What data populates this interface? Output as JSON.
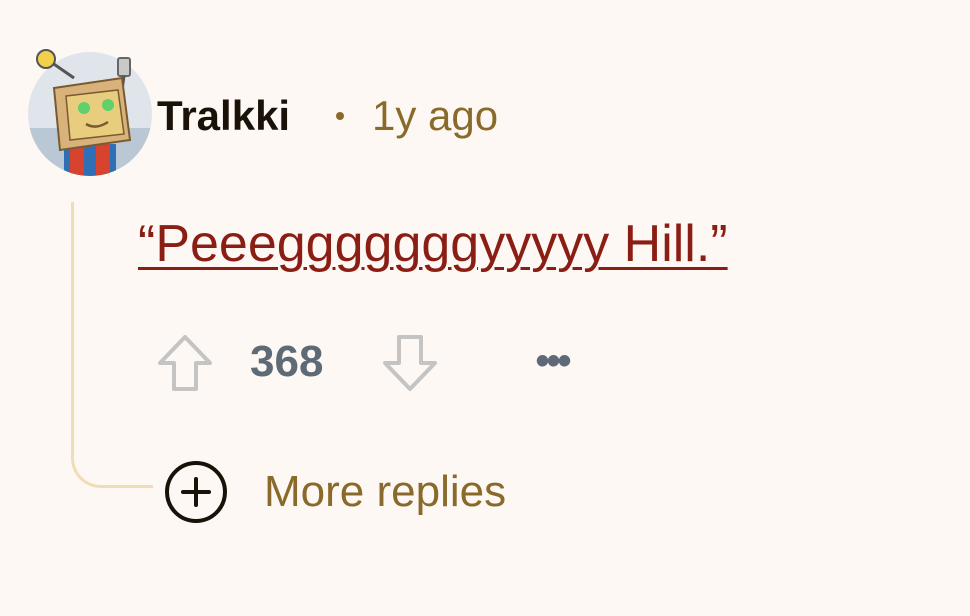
{
  "comment": {
    "author": "Tralkki",
    "separator_icon": "dot-separator",
    "timestamp": "1y ago",
    "body": "“Peeegggggggyyyyy Hill.”"
  },
  "actions": {
    "upvote_icon": "arrow-up-icon",
    "score": "368",
    "downvote_icon": "arrow-down-icon",
    "overflow": "•••"
  },
  "replies": {
    "label": "More replies",
    "icon": "plus-circle-icon"
  },
  "colors": {
    "background": "#fdf8f4",
    "author": "#1a1208",
    "meta": "#8a6a2a",
    "body_link": "#8b1e14",
    "score": "#5e6a75",
    "thread_line": "#f2dcb8"
  }
}
